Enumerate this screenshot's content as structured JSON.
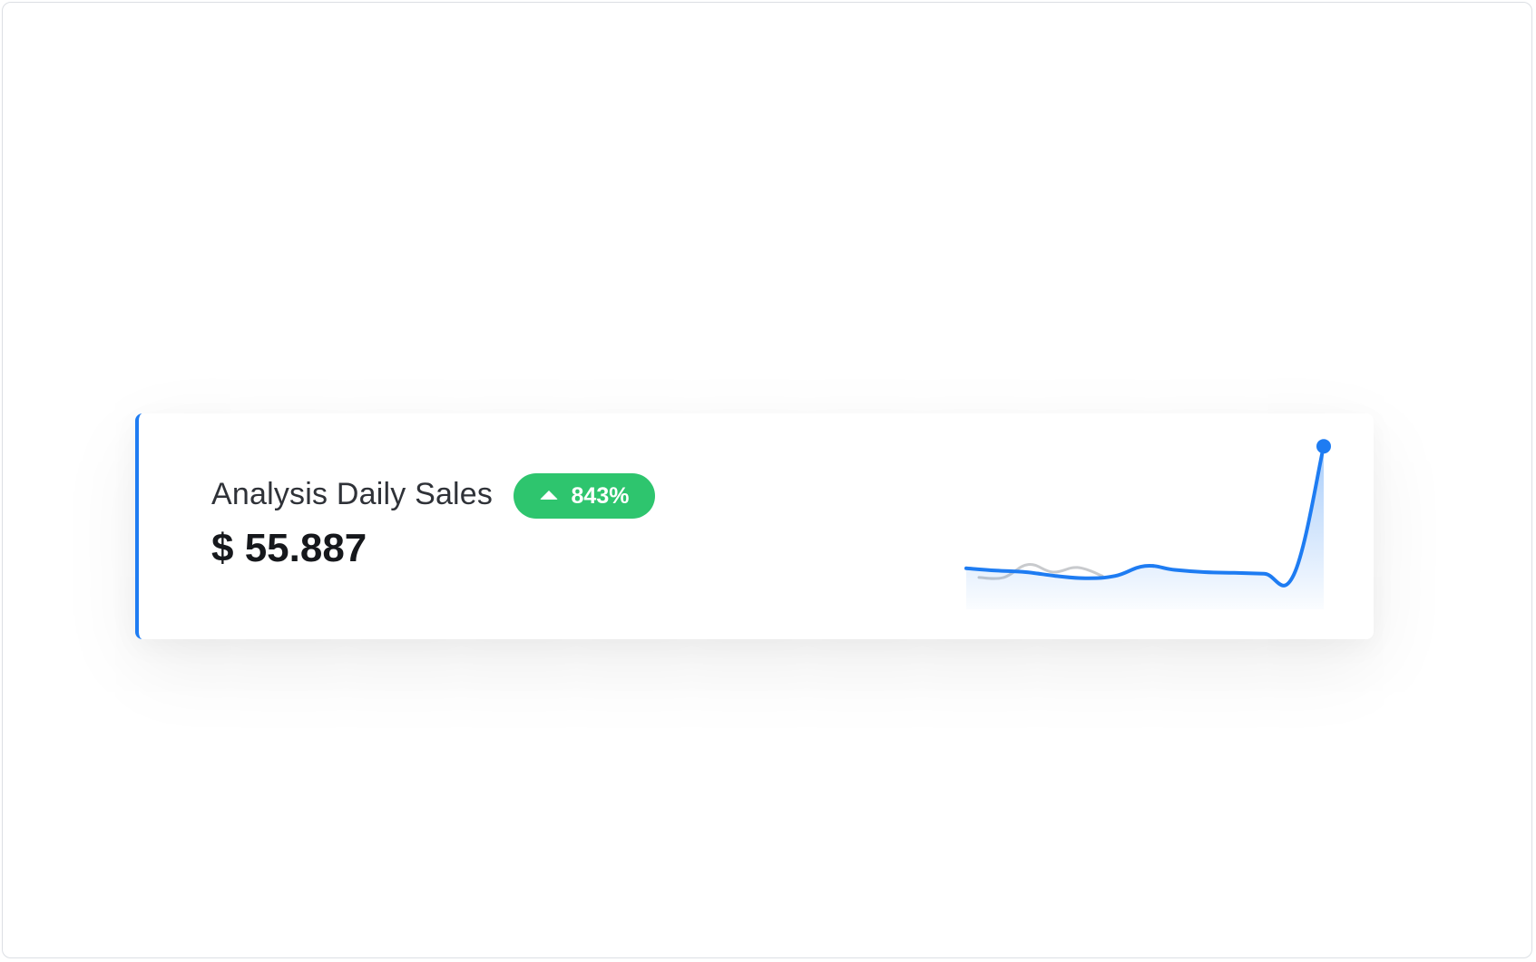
{
  "widget": {
    "title": "Analysis Daily Sales",
    "value": "$ 55.887",
    "change_badge": {
      "text": "843%",
      "direction": "up",
      "color": "#2ec56e"
    },
    "accent_color": "#1e7cf2"
  },
  "chart_data": {
    "type": "line",
    "series": [
      {
        "values": [
          30,
          27,
          25,
          20,
          17,
          20,
          33,
          28,
          25,
          24,
          23,
          22,
          190
        ],
        "color": "#1e7cf2",
        "fill": "gradient",
        "end_marker": true
      },
      {
        "values": [
          18,
          18,
          35,
          25,
          31,
          20
        ],
        "color": "#c8cacd",
        "fill": "none"
      }
    ],
    "ylim": [
      0,
      195
    ],
    "grid": false,
    "legend": "none",
    "axes_visible": false
  }
}
